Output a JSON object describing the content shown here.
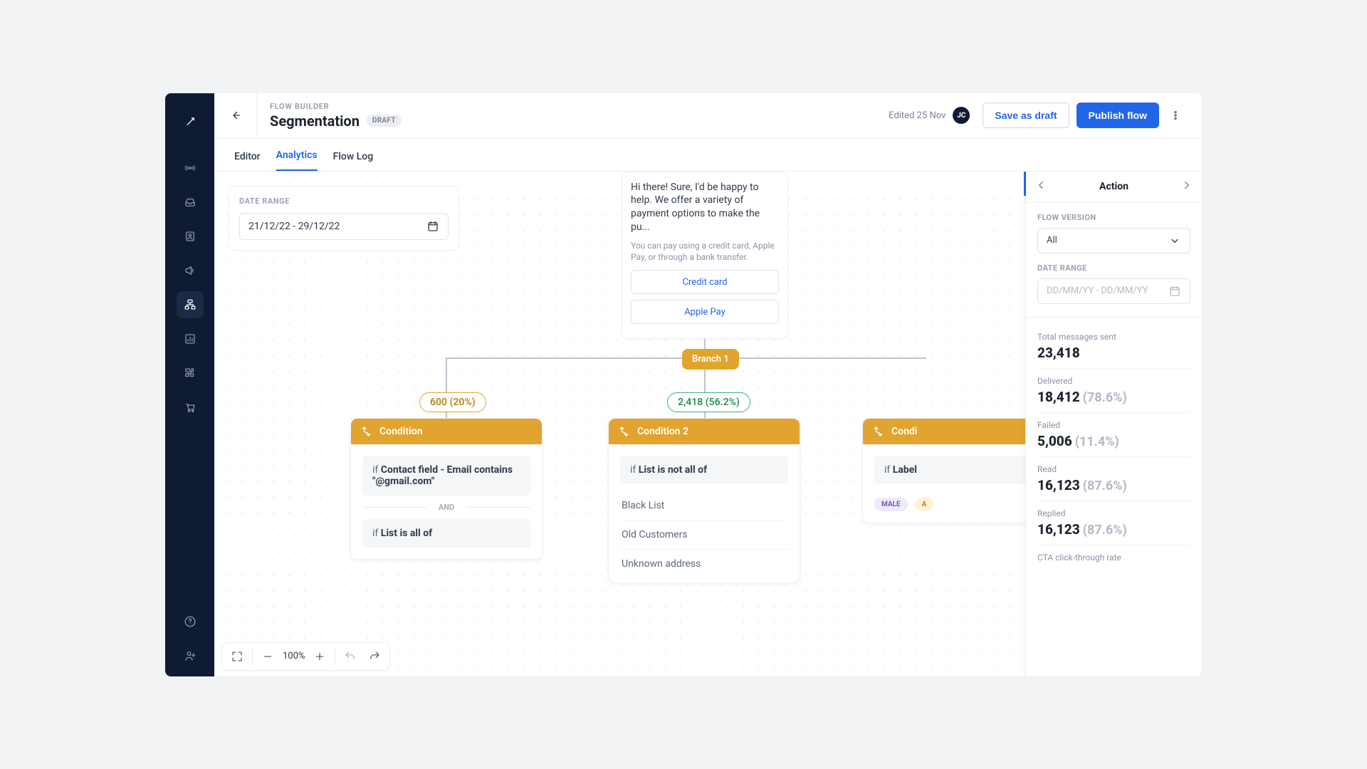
{
  "header": {
    "eyebrow": "FLOW BUILDER",
    "title": "Segmentation",
    "status_badge": "DRAFT",
    "edited_label": "Edited 25 Nov",
    "avatar_initials": "JC",
    "save_draft_label": "Save as draft",
    "publish_label": "Publish flow"
  },
  "tabs": {
    "editor": "Editor",
    "analytics": "Analytics",
    "flow_log": "Flow Log"
  },
  "date_range_card": {
    "label": "DATE RANGE",
    "value": "21/12/22 - 29/12/22"
  },
  "message_card": {
    "text": "Hi there! Sure, I'd be happy to help. We offer a variety of payment options to make the pu...",
    "subtext": "You can pay using a credit card, Apple Pay, or through a bank transfer.",
    "buttons": [
      "Credit card",
      "Apple Pay"
    ]
  },
  "branch": {
    "label": "Branch 1"
  },
  "counts": {
    "left": "600 (20%)",
    "center": "2,418 (56.2%)"
  },
  "conditions": {
    "c1": {
      "title": "Condition",
      "if_prefix": "if ",
      "rule1_strong": "Contact field - Email contains \"@gmail.com\"",
      "and_label": "AND",
      "rule2_strong": "List is all of"
    },
    "c2": {
      "title": "Condition 2",
      "if_prefix": "if ",
      "rule_strong": "List is not all of",
      "lists": [
        "Black List",
        "Old Customers",
        "Unknown address"
      ]
    },
    "c3": {
      "title": "Condi",
      "if_prefix": "if ",
      "rule_strong": "Label",
      "tags": [
        "MALE",
        "A"
      ]
    }
  },
  "panel": {
    "title": "Action",
    "flow_version_label": "FLOW VERSION",
    "flow_version_value": "All",
    "date_label": "DATE RANGE",
    "date_placeholder": "DD/MM/YY - DD/MM/YY",
    "stats": {
      "sent": {
        "label": "Total messages sent",
        "value": "23,418"
      },
      "delivered": {
        "label": "Delivered",
        "value": "18,412",
        "pct": "(78.6%)"
      },
      "failed": {
        "label": "Failed",
        "value": "5,006",
        "pct": "(11.4%)"
      },
      "read": {
        "label": "Read",
        "value": "16,123",
        "pct": "(87.6%)"
      },
      "replied": {
        "label": "Replied",
        "value": "16,123",
        "pct": "(87.6%)"
      },
      "cta": {
        "label": "CTA click-through rate"
      }
    }
  },
  "zoom": {
    "level": "100%"
  }
}
